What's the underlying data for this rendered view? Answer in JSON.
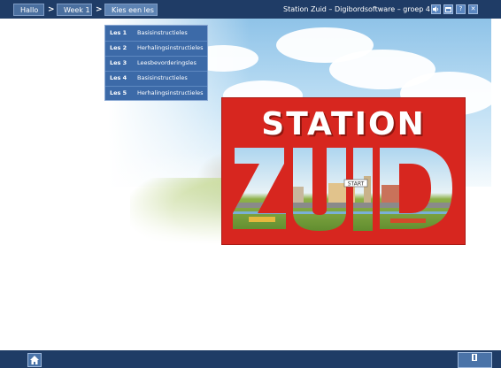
{
  "breadcrumb": {
    "items": [
      {
        "label": "Hallo"
      },
      {
        "label": "Week 1"
      },
      {
        "label": "Kies een les"
      }
    ],
    "separator": ">"
  },
  "app": {
    "title": "Station Zuid – Digibordsoftware – groep 4"
  },
  "window_controls": [
    {
      "icon": "speaker-icon"
    },
    {
      "icon": "restore-window-icon"
    },
    {
      "icon": "help-icon",
      "label": "?"
    },
    {
      "icon": "close-icon",
      "label": "✕"
    }
  ],
  "lesson_menu": {
    "items": [
      {
        "number": "Les 1",
        "label": "Basisinstructieles"
      },
      {
        "number": "Les 2",
        "label": "Herhalingsinstructieles"
      },
      {
        "number": "Les 3",
        "label": "Leesbevorderingsles"
      },
      {
        "number": "Les 4",
        "label": "Basisinstructieles"
      },
      {
        "number": "Les 5",
        "label": "Herhalingsinstructieles"
      }
    ]
  },
  "logo": {
    "line1": "STATION",
    "line2": "ZUID",
    "sign_text": "START"
  },
  "bottom": {
    "home_icon": "home-icon",
    "exit_icon": "exit-door-icon"
  },
  "colors": {
    "bar": "#1f3c66",
    "menu": "#3c6aa8",
    "logo_red": "#d7261f"
  }
}
